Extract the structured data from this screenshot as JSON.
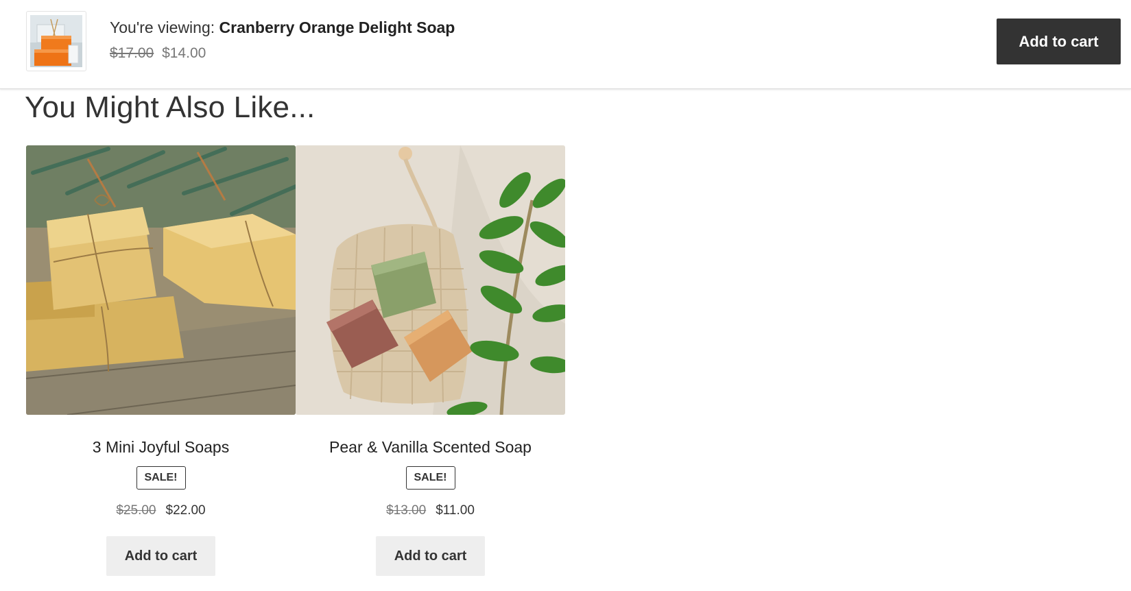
{
  "sticky_bar": {
    "viewing_prefix": "You're viewing: ",
    "product_name": "Cranberry Orange Delight Soap",
    "old_price": "$17.00",
    "price": "$14.00",
    "add_to_cart_label": "Add to cart",
    "thumbnail_icon": "orange-soap-stack-image",
    "button_color": "#333333"
  },
  "related": {
    "title": "You Might Also Like...",
    "products": [
      {
        "name": "3 Mini Joyful Soaps",
        "badge": "SALE!",
        "old_price": "$25.00",
        "price": "$22.00",
        "add_to_cart_label": "Add to cart",
        "image_icon": "wrapped-yellow-soaps-image"
      },
      {
        "name": "Pear & Vanilla Scented Soap",
        "badge": "SALE!",
        "old_price": "$13.00",
        "price": "$11.00",
        "add_to_cart_label": "Add to cart",
        "image_icon": "soap-bars-on-mesh-bag-image"
      }
    ]
  }
}
